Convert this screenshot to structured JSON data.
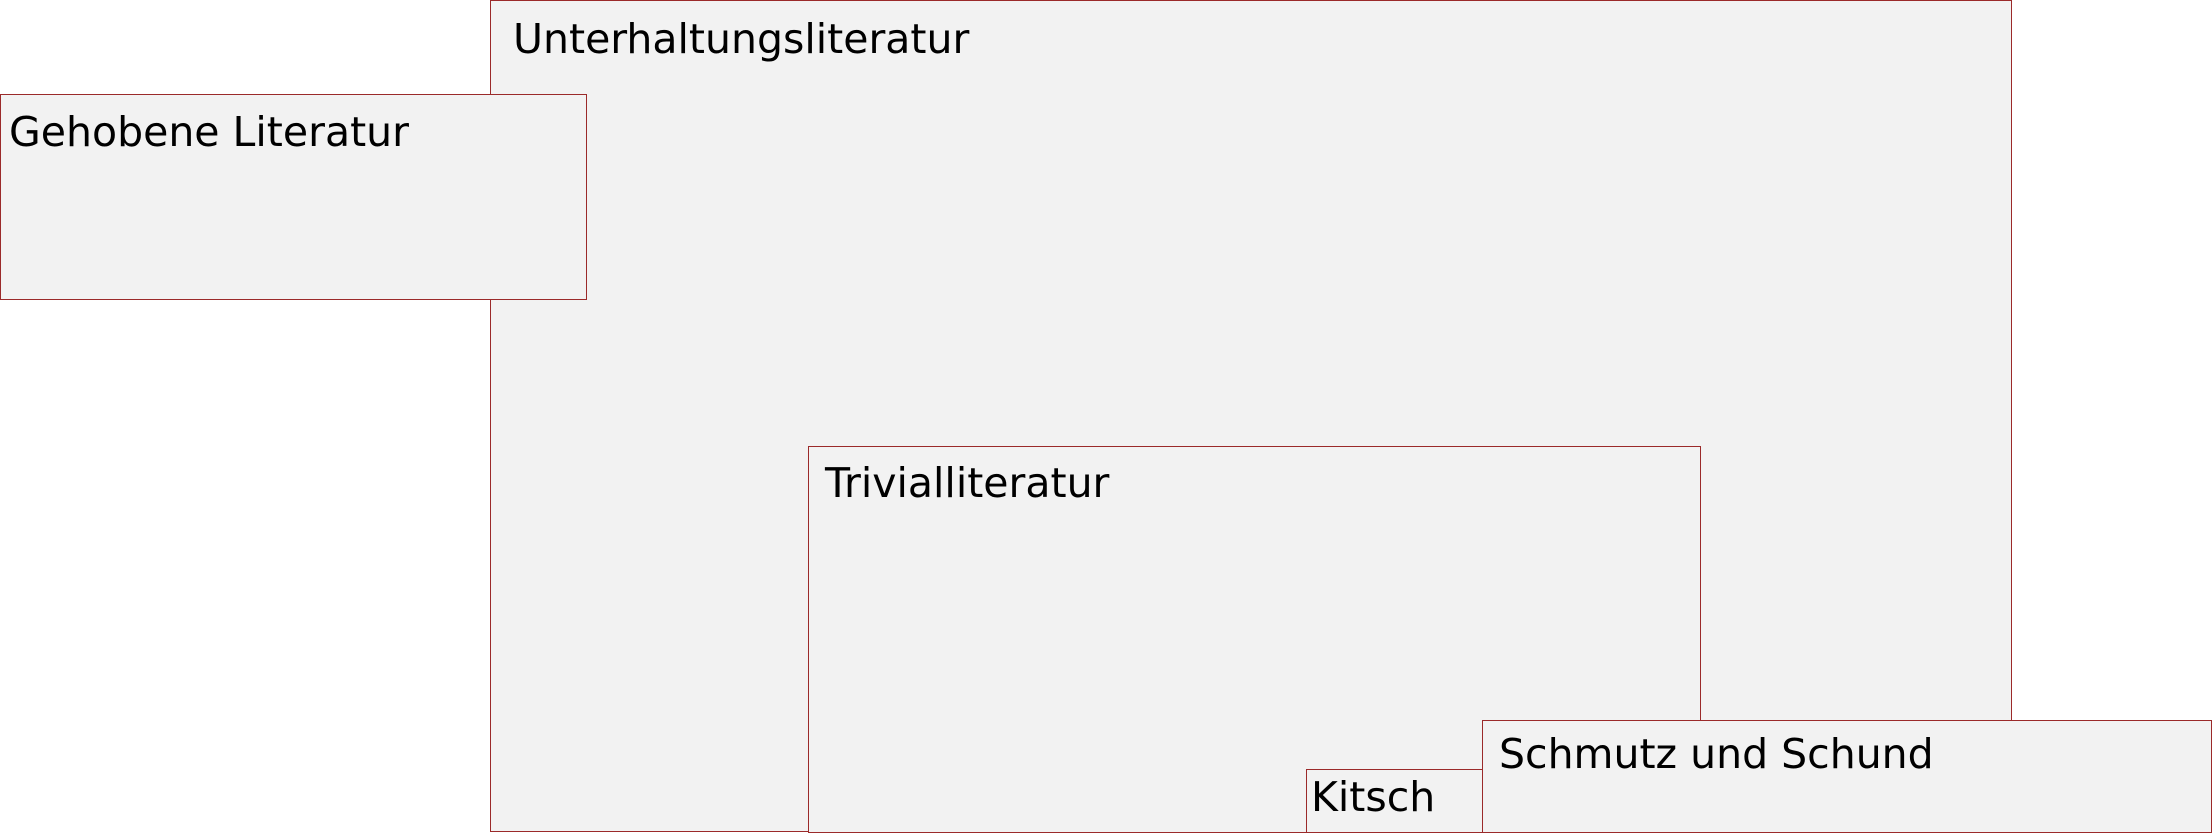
{
  "diagram": {
    "nodes": [
      {
        "id": "unterhaltungsliteratur",
        "label": "Unterhaltungsliteratur"
      },
      {
        "id": "gehobene-literatur",
        "label": "Gehobene Literatur"
      },
      {
        "id": "trivialliteratur",
        "label": "Trivialliteratur"
      },
      {
        "id": "kitsch",
        "label": "Kitsch"
      },
      {
        "id": "schmutz-und-schund",
        "label": "Schmutz und Schund"
      }
    ],
    "colors": {
      "box_fill": "#f2f2f2",
      "box_border": "#9b2a2a",
      "text": "#000000",
      "background": "#ffffff"
    }
  }
}
